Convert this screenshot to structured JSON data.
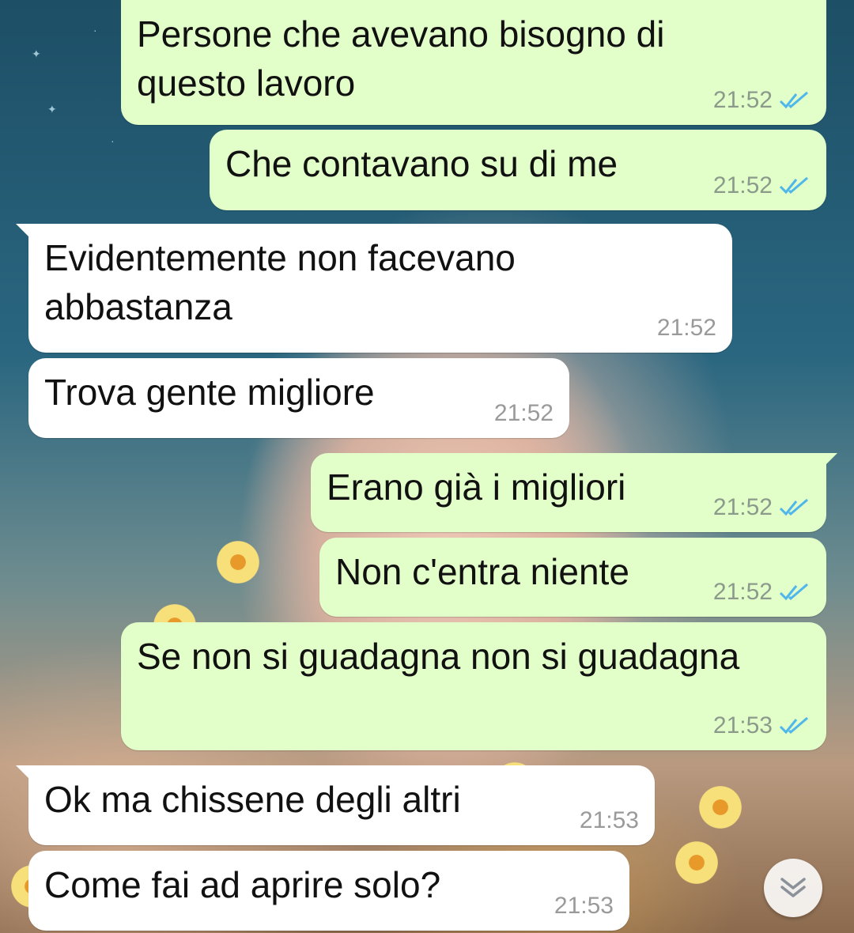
{
  "chat": {
    "messages": [
      {
        "direction": "out",
        "text": "Persone che avevano bisogno di\nquesto lavoro",
        "time": "21:52",
        "status": "read"
      },
      {
        "direction": "out",
        "text": "Che contavano su di me",
        "time": "21:52",
        "status": "read"
      },
      {
        "direction": "in",
        "text": "Evidentemente non facevano\nabbastanza",
        "time": "21:52"
      },
      {
        "direction": "in",
        "text": "Trova gente migliore",
        "time": "21:52"
      },
      {
        "direction": "out",
        "text": "Erano già i migliori",
        "time": "21:52",
        "status": "read"
      },
      {
        "direction": "out",
        "text": "Non c'entra niente",
        "time": "21:52",
        "status": "read"
      },
      {
        "direction": "out",
        "text": "Se non si guadagna non si guadagna",
        "time": "21:53",
        "status": "read"
      },
      {
        "direction": "in",
        "text": "Ok ma chissene degli altri",
        "time": "21:53"
      },
      {
        "direction": "in",
        "text": "Come fai ad aprire solo?",
        "time": "21:53"
      }
    ]
  },
  "icons": {
    "read_receipt": "double-check-icon",
    "scroll_down": "chevron-double-down-icon"
  },
  "colors": {
    "outgoing_bubble": "#e2ffc9",
    "incoming_bubble": "#ffffff",
    "read_tick": "#4fb6ec"
  }
}
